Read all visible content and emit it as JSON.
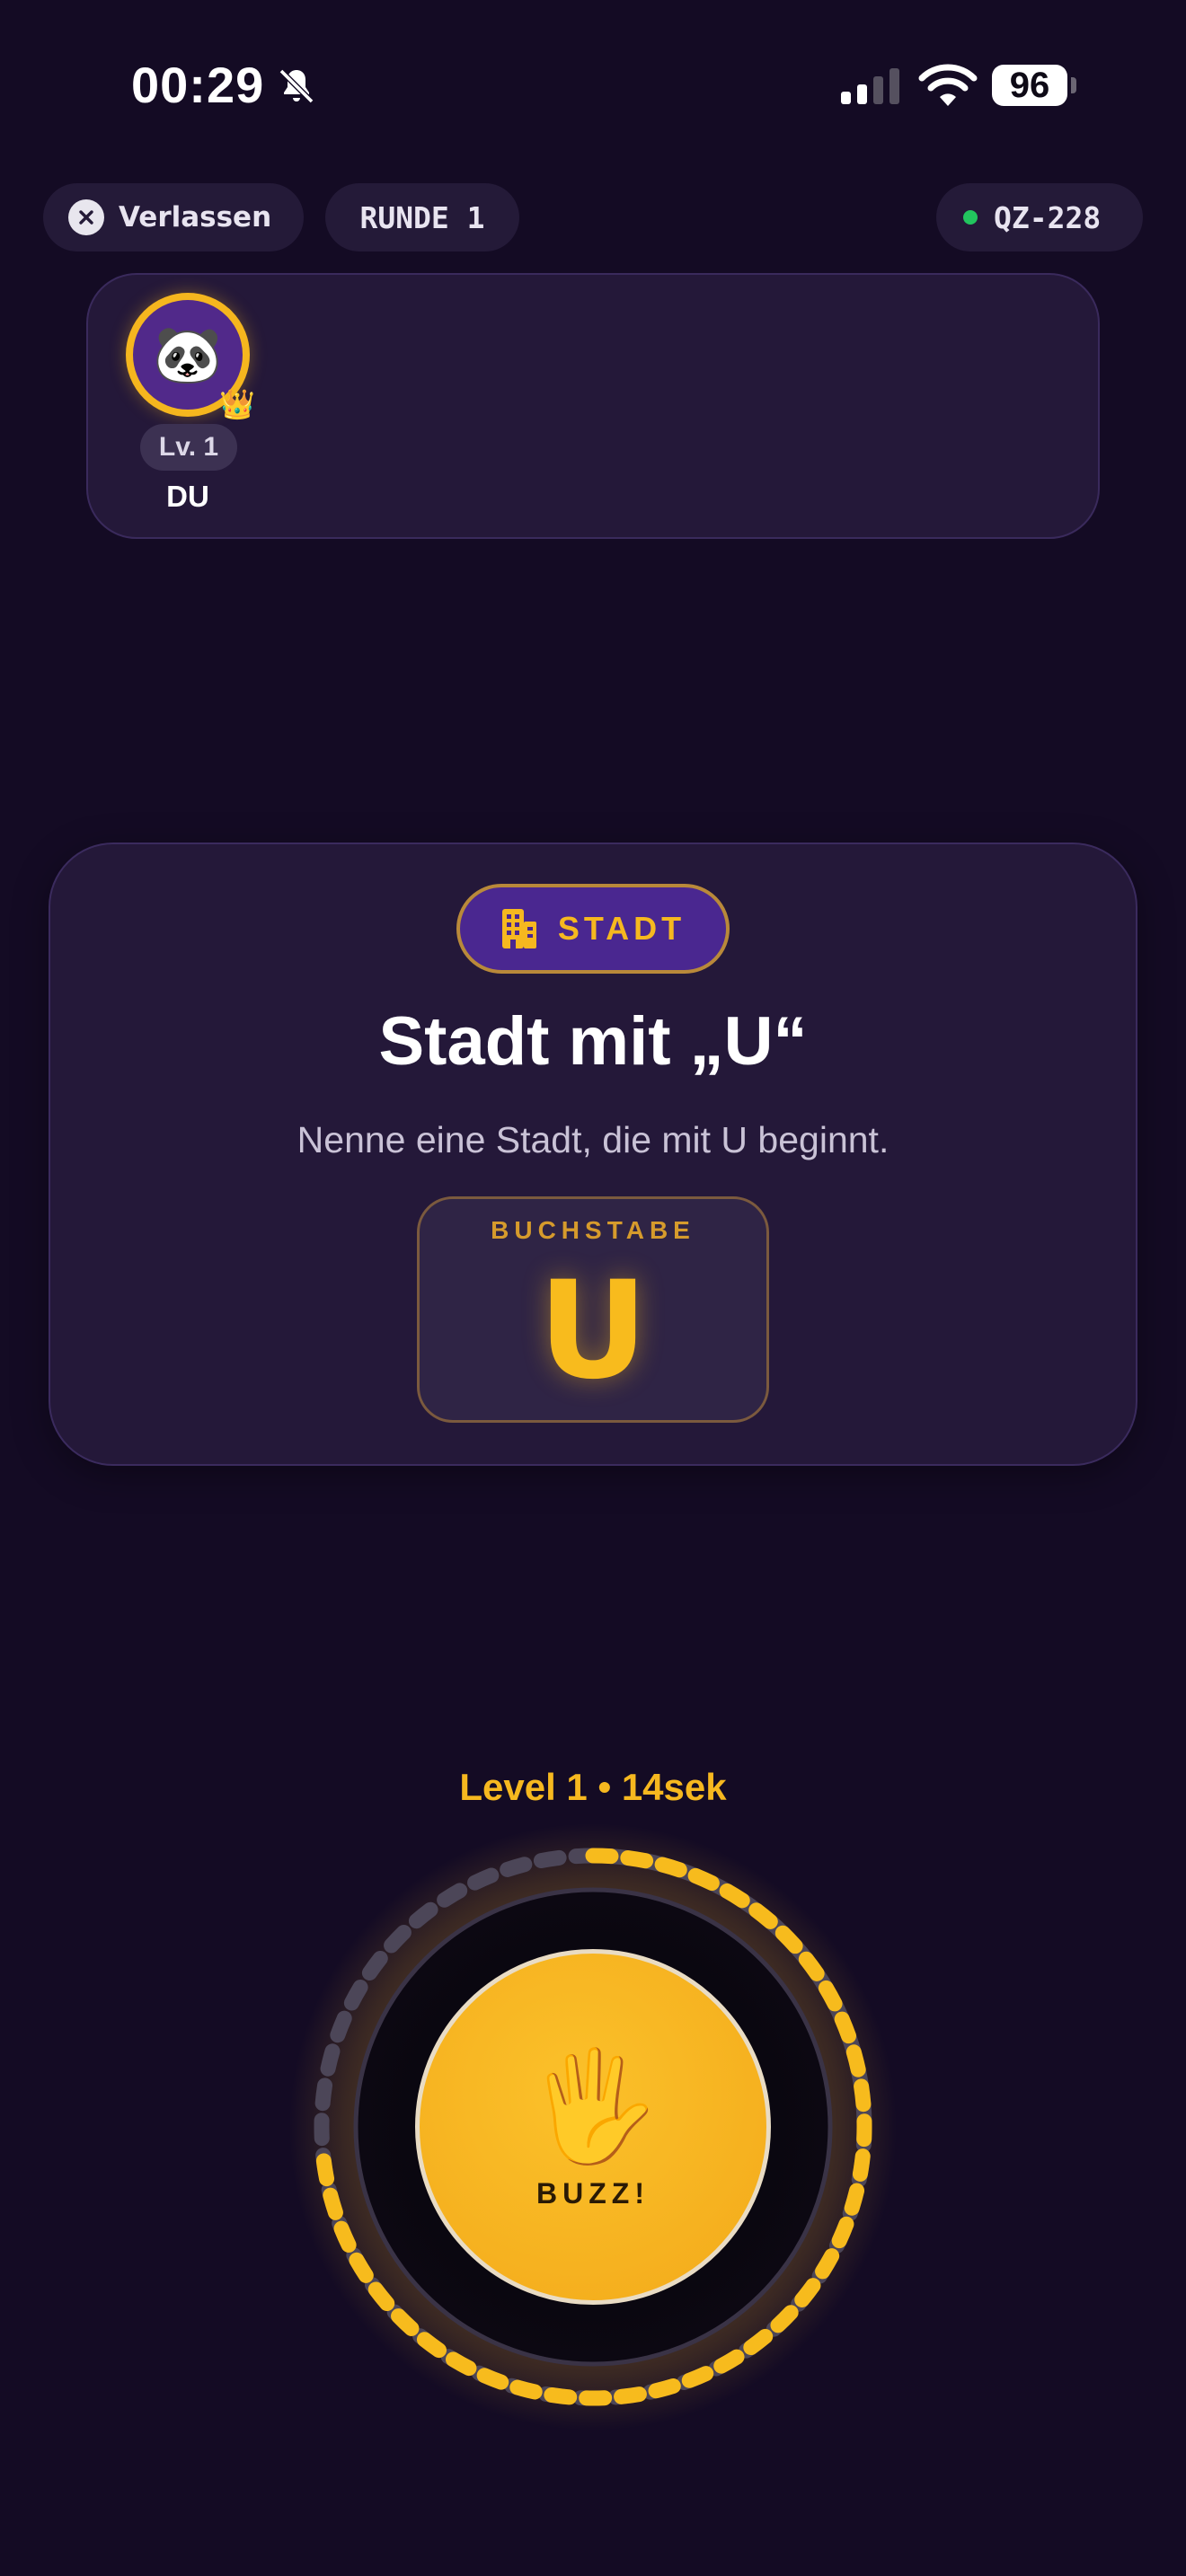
{
  "status_bar": {
    "time": "00:29",
    "battery": "96",
    "icons": [
      "bell-slash-icon",
      "cellular-signal-icon",
      "wifi-icon",
      "battery-icon"
    ]
  },
  "header": {
    "leave_label": "Verlassen",
    "round_label": "RUNDE 1",
    "room_code": "QZ-228",
    "room_status_color": "#22c55e"
  },
  "players": [
    {
      "avatar": "🐼",
      "level": "Lv. 1",
      "name": "DU",
      "badge": "👑",
      "ring_color": "#f5b61e"
    }
  ],
  "question": {
    "category_icon": "building-icon",
    "category": "STADT",
    "title": "Stadt mit „U“",
    "hint": "Nenne eine Stadt, die mit U beginnt.",
    "letter_caption": "BUCHSTABE",
    "letter": "U"
  },
  "timer": {
    "label": "Level 1 • 14sek",
    "remaining_fraction": 0.72
  },
  "buzzer": {
    "emoji": "🖐️",
    "label": "BUZZ!"
  },
  "colors": {
    "background": "#140b24",
    "accent": "#f6b81f",
    "card": "#241839"
  }
}
